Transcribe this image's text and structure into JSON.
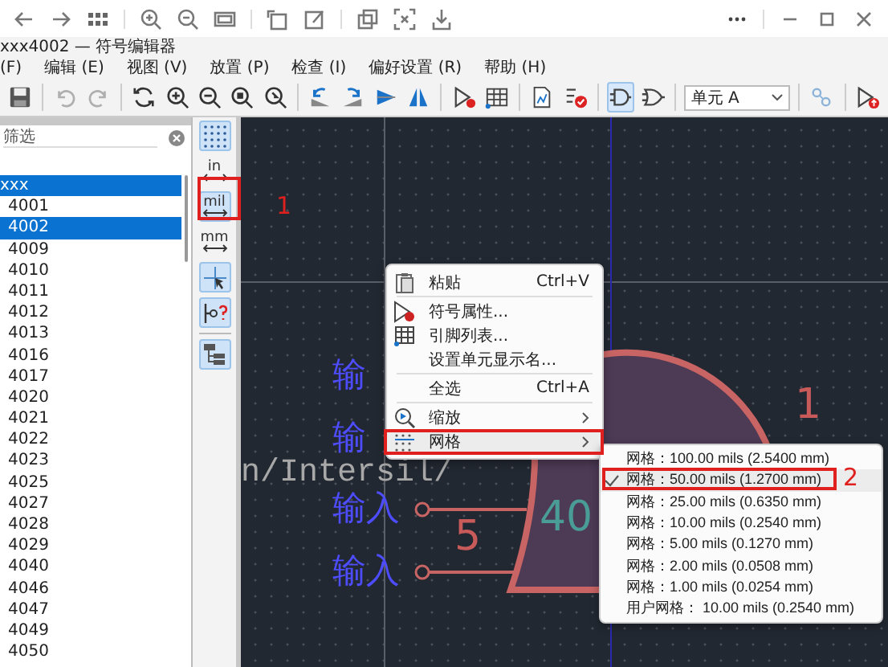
{
  "window": {
    "title": "xxx4002 — 符号编辑器"
  },
  "menu_bar": [
    "(F)",
    "编辑 (E)",
    "视图 (V)",
    "放置 (P)",
    "检查 (I)",
    "偏好设置 (R)",
    "帮助 (H)"
  ],
  "toolbar": {
    "history_buttons": [
      {
        "kind": "undo",
        "disabled": true
      },
      {
        "kind": "redo",
        "disabled": true
      }
    ],
    "pin_view_toggles": [
      {
        "selected": true
      },
      {
        "selected": false
      }
    ],
    "unit_select": {
      "value": "单元 A"
    }
  },
  "library_panel": {
    "filter": {
      "placeholder": "筛选"
    },
    "tree": {
      "label": "xxx",
      "selected": true,
      "children": [
        {
          "label": "4001",
          "selected": false
        },
        {
          "label": "4002",
          "selected": true
        },
        {
          "label": "4009",
          "selected": false
        },
        {
          "label": "4010",
          "selected": false
        },
        {
          "label": "4011",
          "selected": false
        },
        {
          "label": "4012",
          "selected": false
        },
        {
          "label": "4013",
          "selected": false
        },
        {
          "label": "4016",
          "selected": false
        },
        {
          "label": "4017",
          "selected": false
        },
        {
          "label": "4020",
          "selected": false
        },
        {
          "label": "4021",
          "selected": false
        },
        {
          "label": "4022",
          "selected": false
        },
        {
          "label": "4023",
          "selected": false
        },
        {
          "label": "4025",
          "selected": false
        },
        {
          "label": "4027",
          "selected": false
        },
        {
          "label": "4028",
          "selected": false
        },
        {
          "label": "4029",
          "selected": false
        },
        {
          "label": "4040",
          "selected": false
        },
        {
          "label": "4046",
          "selected": false
        },
        {
          "label": "4047",
          "selected": false
        },
        {
          "label": "4049",
          "selected": false
        },
        {
          "label": "4050",
          "selected": false
        }
      ]
    }
  },
  "side_toolbar": [
    {
      "kind": "grid",
      "on": true
    },
    {
      "kind": "unit",
      "label": "in",
      "selected": false
    },
    {
      "kind": "unit",
      "label": "mil",
      "selected": true
    },
    {
      "kind": "unit",
      "label": "mm",
      "selected": false
    },
    {
      "kind": "cursor",
      "on": true
    },
    {
      "kind": "pin-check",
      "on": true
    },
    {
      "kind": "hierarchy",
      "on": true
    }
  ],
  "canvas": {
    "symbol_texts": [
      {
        "kind": "pin-name",
        "text": "输"
      },
      {
        "kind": "pin-number",
        "text": "1"
      },
      {
        "kind": "pin-name",
        "text": "输"
      },
      {
        "kind": "field",
        "text": "n/Intersil/"
      },
      {
        "kind": "pin-name",
        "text": "输入"
      },
      {
        "kind": "pin-number",
        "text": "5"
      },
      {
        "kind": "value",
        "text": "40"
      },
      {
        "kind": "pin-name",
        "text": "输入"
      }
    ]
  },
  "context_menu": {
    "items": [
      {
        "kind": "action",
        "label": "粘贴",
        "shortcut": "Ctrl+V",
        "selected": false
      },
      {
        "kind": "separator"
      },
      {
        "kind": "action",
        "label": "符号属性...",
        "selected": false
      },
      {
        "kind": "action",
        "label": "引脚列表...",
        "selected": false
      },
      {
        "kind": "action",
        "label": "设置单元显示名...",
        "selected": false
      },
      {
        "kind": "separator"
      },
      {
        "kind": "action",
        "label": "全选",
        "shortcut": "Ctrl+A",
        "selected": false
      },
      {
        "kind": "separator"
      },
      {
        "kind": "submenu",
        "label": "缩放",
        "selected": false
      },
      {
        "kind": "submenu",
        "label": "网格",
        "selected": true
      }
    ]
  },
  "grid_submenu": {
    "items": [
      {
        "label": "网格：100.00 mils (2.5400 mm)",
        "checked": false,
        "selected": false
      },
      {
        "label": "网格：50.00 mils (1.2700 mm)",
        "checked": true,
        "selected": true
      },
      {
        "label": "网格：25.00 mils (0.6350 mm)",
        "checked": false,
        "selected": false
      },
      {
        "label": "网格：10.00 mils (0.2540 mm)",
        "checked": false,
        "selected": false
      },
      {
        "label": "网格：5.00 mils (0.1270 mm)",
        "checked": false,
        "selected": false
      },
      {
        "label": "网格：2.00 mils (0.0508 mm)",
        "checked": false,
        "selected": false
      },
      {
        "label": "网格：1.00 mils (0.0254 mm)",
        "checked": false,
        "selected": false
      },
      {
        "label": "用户网格： 10.00 mils (0.2540 mm)",
        "checked": false,
        "selected": false
      }
    ]
  },
  "annotations": [
    {
      "label": "1"
    },
    {
      "label": "2"
    }
  ]
}
